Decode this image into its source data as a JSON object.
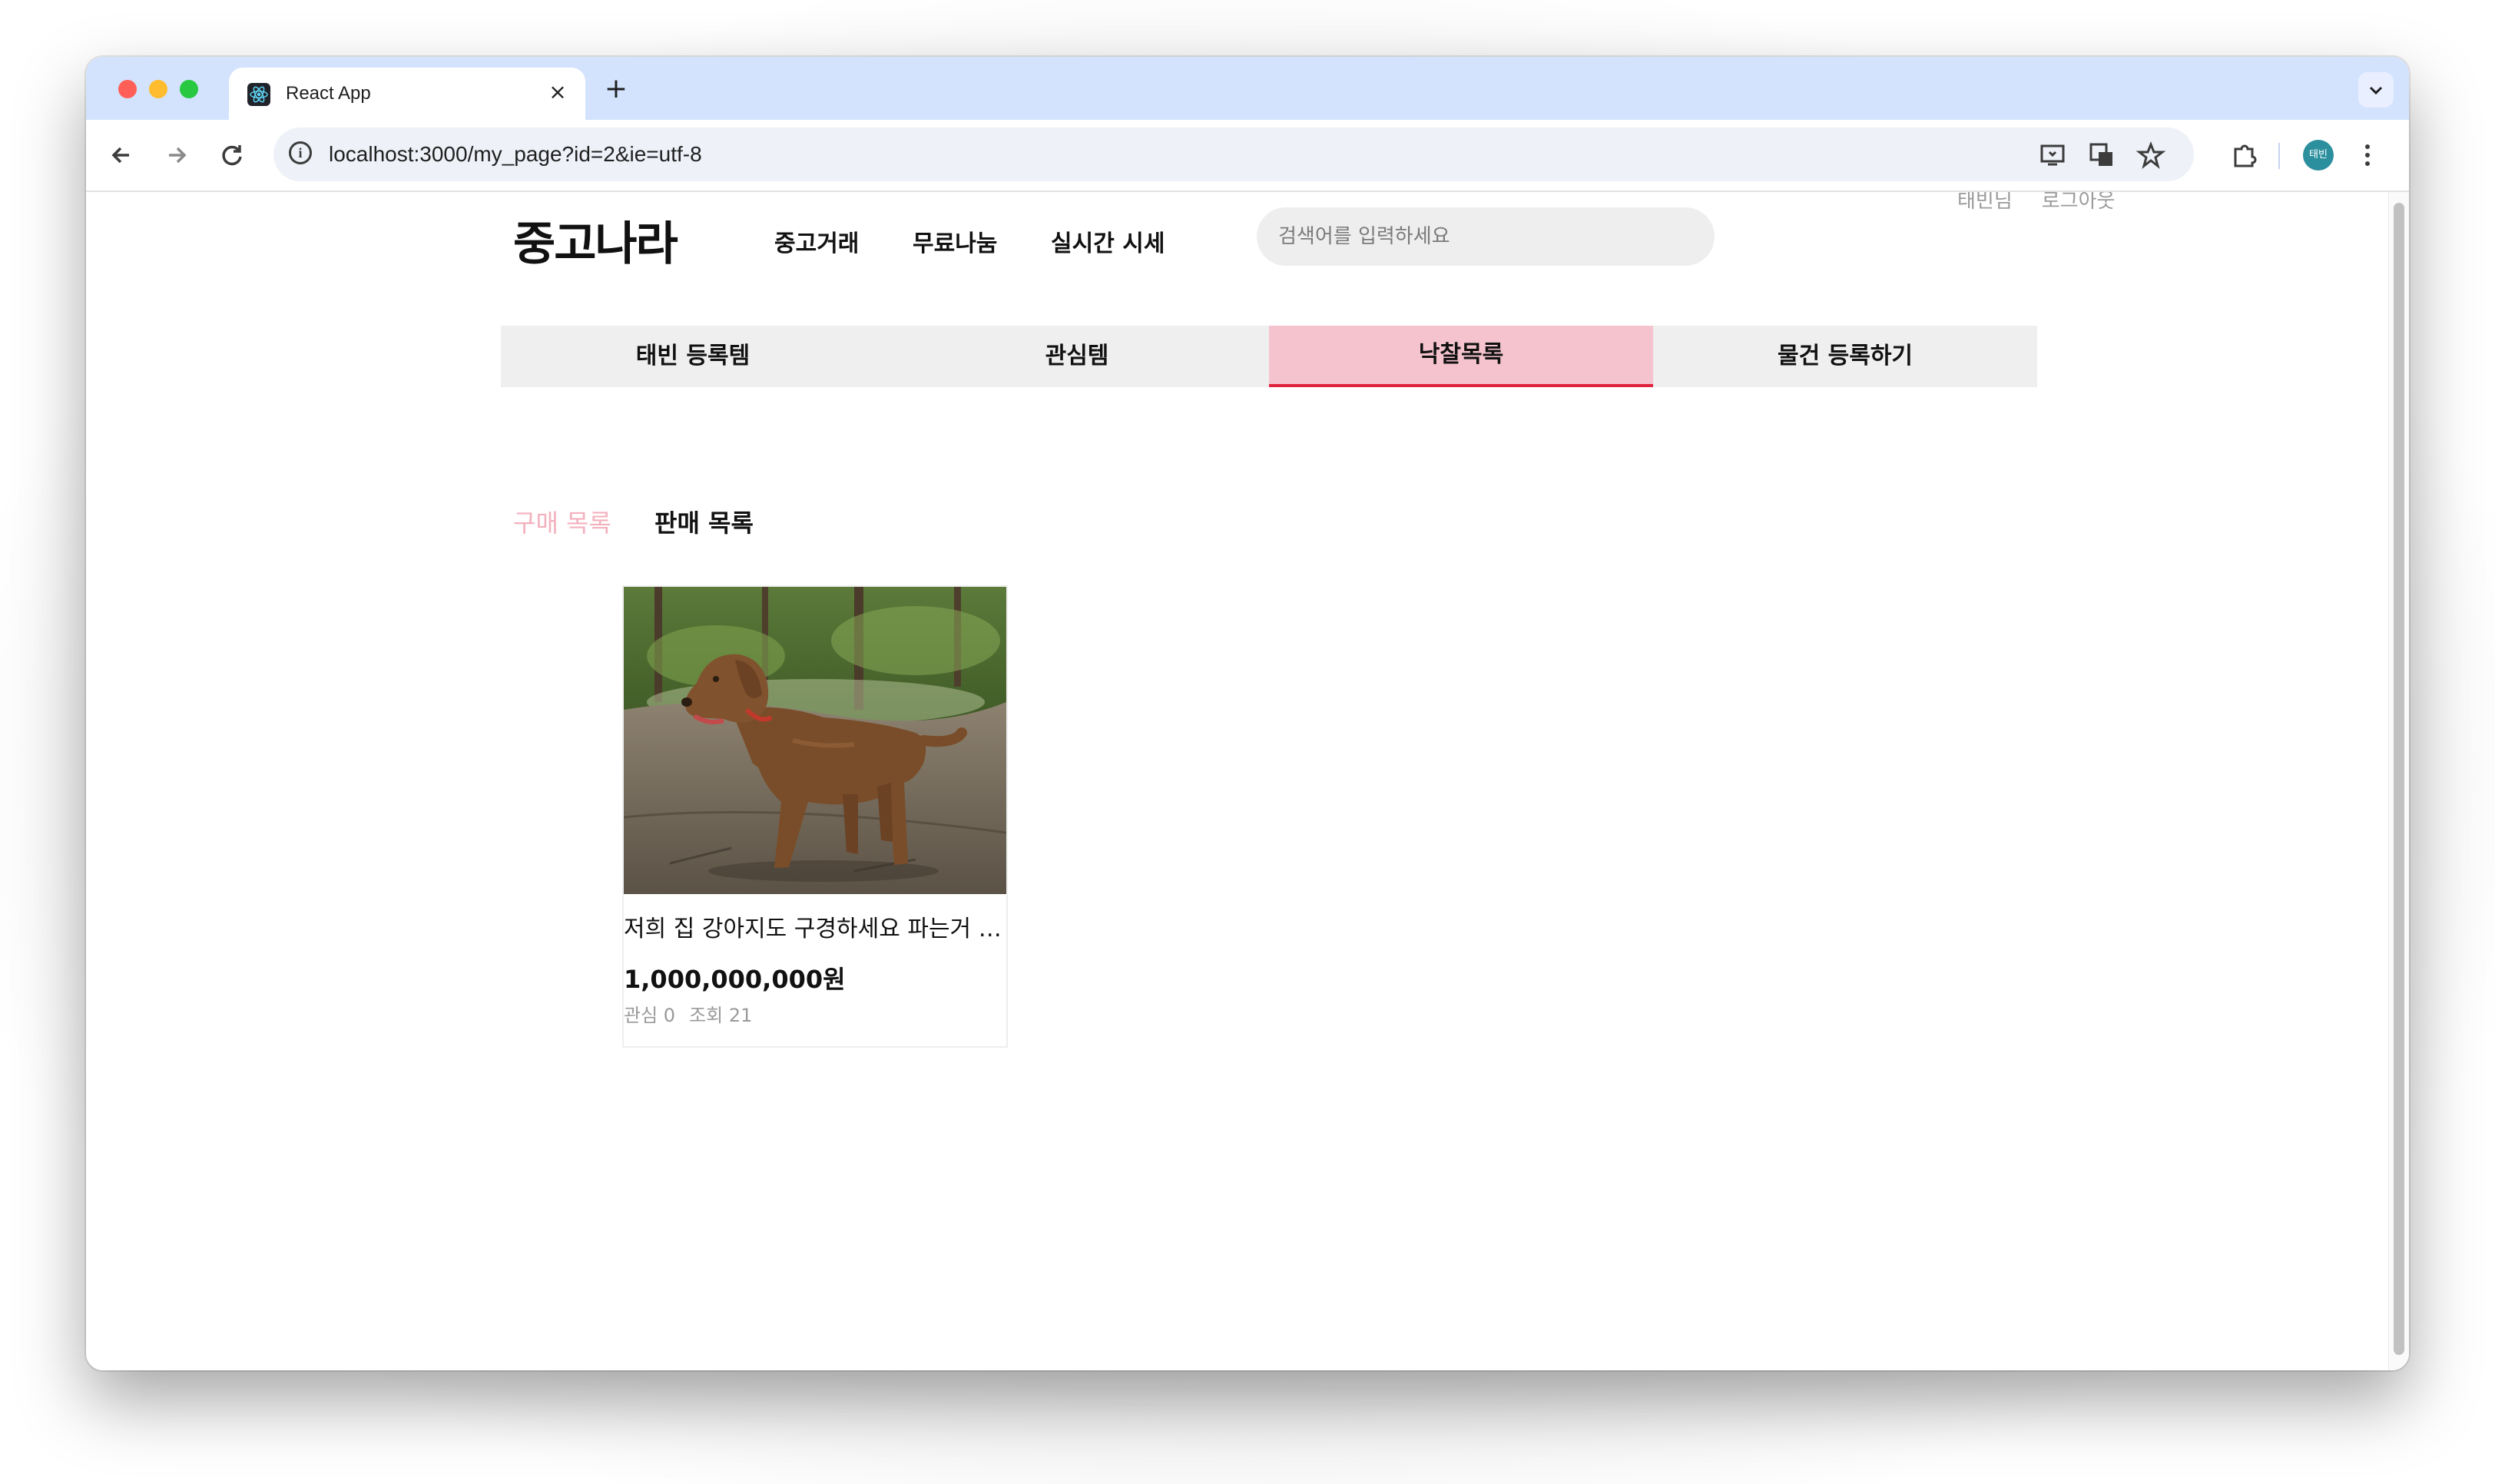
{
  "browser": {
    "tab_title": "React App",
    "new_tab_symbol": "+",
    "close_symbol": "×",
    "url": "localhost:3000/my_page?id=2&ie=utf-8",
    "profile_initials": "태빈"
  },
  "header": {
    "logo": "중고나라",
    "nav": [
      "중고거래",
      "무료나눔",
      "실시간 시세"
    ],
    "search_placeholder": "검색어를 입력하세요",
    "user_name": "태빈님",
    "logout": "로그아웃"
  },
  "mypage_tabs": [
    {
      "label": "태빈 등록템",
      "active": false
    },
    {
      "label": "관심템",
      "active": false
    },
    {
      "label": "낙찰목록",
      "active": true
    },
    {
      "label": "물건 등록하기",
      "active": false
    }
  ],
  "sub_tabs": {
    "purchase": "구매 목록",
    "sales": "판매 목록"
  },
  "items": [
    {
      "title": "저희 집 강아지도 구경하세요 파는거 아니에요",
      "price": "1,000,000,000원",
      "likes": "관심 0",
      "views": "조회 21"
    }
  ],
  "colors": {
    "active_tab_bg": "#f5c3ce",
    "active_tab_border": "#e0223d",
    "inactive_subtab": "#f3b0bd"
  }
}
